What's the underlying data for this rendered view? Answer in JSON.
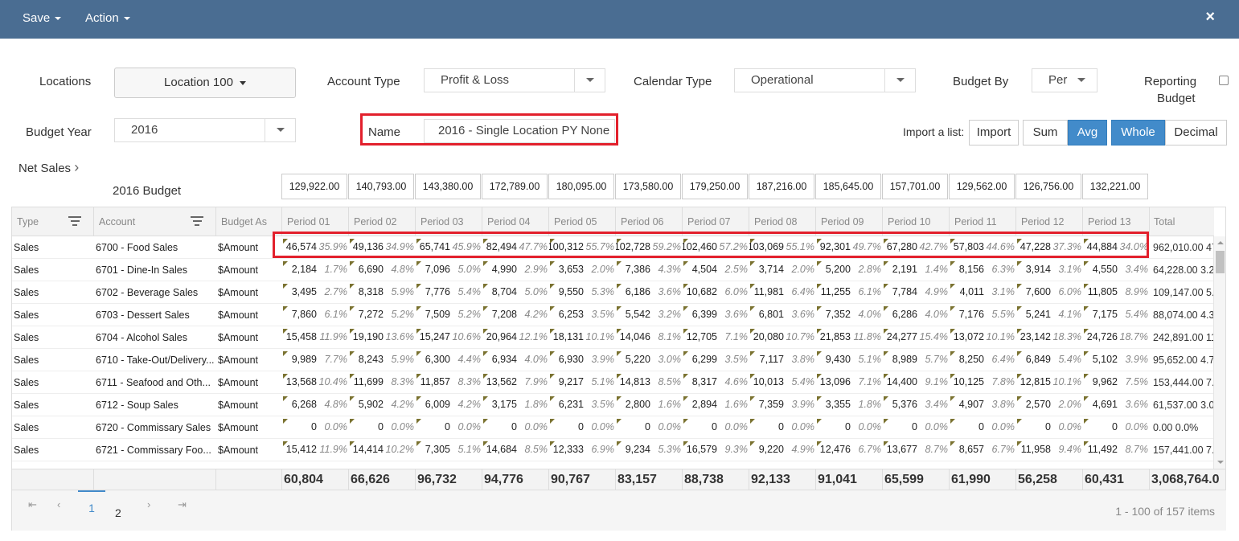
{
  "topbar": {
    "save_label": "Save",
    "action_label": "Action",
    "close_icon": "×"
  },
  "filters": {
    "locations_label": "Locations",
    "location_value": "Location 100",
    "account_type_label": "Account Type",
    "account_type_value": "Profit & Loss",
    "calendar_type_label": "Calendar Type",
    "calendar_type_value": "Operational",
    "budget_by_label": "Budget By",
    "budget_by_value": "Per",
    "reporting_budget_label_1": "Reporting",
    "reporting_budget_label_2": "Budget",
    "budget_year_label": "Budget Year",
    "budget_year_value": "2016",
    "name_label": "Name",
    "name_value": "2016 - Single Location PY None",
    "import_list_label": "Import a list:",
    "import_button": "Import",
    "sum_button": "Sum",
    "avg_button": "Avg",
    "whole_button": "Whole",
    "decimal_button": "Decimal"
  },
  "net_sales_label": "Net Sales",
  "budget_row": {
    "label": "2016 Budget",
    "values": [
      "129,922.00",
      "140,793.00",
      "143,380.00",
      "172,789.00",
      "180,095.00",
      "173,580.00",
      "179,250.00",
      "187,216.00",
      "185,645.00",
      "157,701.00",
      "129,562.00",
      "126,756.00",
      "132,221.00"
    ]
  },
  "grid": {
    "columns": {
      "type": "Type",
      "account": "Account",
      "budget_as": "Budget As",
      "periods": [
        "Period 01",
        "Period 02",
        "Period 03",
        "Period 04",
        "Period 05",
        "Period 06",
        "Period 07",
        "Period 08",
        "Period 09",
        "Period 10",
        "Period 11",
        "Period 12",
        "Period 13"
      ],
      "total": "Total"
    },
    "rows": [
      {
        "type": "Sales",
        "account": "6700 - Food Sales",
        "budget_as": "$Amount",
        "cells": [
          [
            "46,574",
            "35.9%"
          ],
          [
            "49,136",
            "34.9%"
          ],
          [
            "65,741",
            "45.9%"
          ],
          [
            "82,494",
            "47.7%"
          ],
          [
            "100,312",
            "55.7%"
          ],
          [
            "102,728",
            "59.2%"
          ],
          [
            "102,460",
            "57.2%"
          ],
          [
            "103,069",
            "55.1%"
          ],
          [
            "92,301",
            "49.7%"
          ],
          [
            "67,280",
            "42.7%"
          ],
          [
            "57,803",
            "44.6%"
          ],
          [
            "47,228",
            "37.3%"
          ],
          [
            "44,884",
            "34.0%"
          ]
        ],
        "total": "962,010.00 47"
      },
      {
        "type": "Sales",
        "account": "6701 - Dine-In Sales",
        "budget_as": "$Amount",
        "cells": [
          [
            "2,184",
            "1.7%"
          ],
          [
            "6,690",
            "4.8%"
          ],
          [
            "7,096",
            "5.0%"
          ],
          [
            "4,990",
            "2.9%"
          ],
          [
            "3,653",
            "2.0%"
          ],
          [
            "7,386",
            "4.3%"
          ],
          [
            "4,504",
            "2.5%"
          ],
          [
            "3,714",
            "2.0%"
          ],
          [
            "5,200",
            "2.8%"
          ],
          [
            "2,191",
            "1.4%"
          ],
          [
            "8,156",
            "6.3%"
          ],
          [
            "3,914",
            "3.1%"
          ],
          [
            "4,550",
            "3.4%"
          ]
        ],
        "total": "64,228.00 3.2"
      },
      {
        "type": "Sales",
        "account": "6702 - Beverage Sales",
        "budget_as": "$Amount",
        "cells": [
          [
            "3,495",
            "2.7%"
          ],
          [
            "8,318",
            "5.9%"
          ],
          [
            "7,776",
            "5.4%"
          ],
          [
            "8,704",
            "5.0%"
          ],
          [
            "9,550",
            "5.3%"
          ],
          [
            "6,186",
            "3.6%"
          ],
          [
            "10,682",
            "6.0%"
          ],
          [
            "11,981",
            "6.4%"
          ],
          [
            "11,255",
            "6.1%"
          ],
          [
            "7,784",
            "4.9%"
          ],
          [
            "4,011",
            "3.1%"
          ],
          [
            "7,600",
            "6.0%"
          ],
          [
            "11,805",
            "8.9%"
          ]
        ],
        "total": "109,147.00 5.4"
      },
      {
        "type": "Sales",
        "account": "6703 - Dessert Sales",
        "budget_as": "$Amount",
        "cells": [
          [
            "7,860",
            "6.1%"
          ],
          [
            "7,272",
            "5.2%"
          ],
          [
            "7,509",
            "5.2%"
          ],
          [
            "7,208",
            "4.2%"
          ],
          [
            "6,253",
            "3.5%"
          ],
          [
            "5,542",
            "3.2%"
          ],
          [
            "6,399",
            "3.6%"
          ],
          [
            "6,801",
            "3.6%"
          ],
          [
            "7,352",
            "4.0%"
          ],
          [
            "6,286",
            "4.0%"
          ],
          [
            "7,176",
            "5.5%"
          ],
          [
            "5,241",
            "4.1%"
          ],
          [
            "7,175",
            "5.4%"
          ]
        ],
        "total": "88,074.00 4.3"
      },
      {
        "type": "Sales",
        "account": "6704 - Alcohol Sales",
        "budget_as": "$Amount",
        "cells": [
          [
            "15,458",
            "11.9%"
          ],
          [
            "19,190",
            "13.6%"
          ],
          [
            "15,247",
            "10.6%"
          ],
          [
            "20,964",
            "12.1%"
          ],
          [
            "18,131",
            "10.1%"
          ],
          [
            "14,046",
            "8.1%"
          ],
          [
            "12,705",
            "7.1%"
          ],
          [
            "20,080",
            "10.7%"
          ],
          [
            "21,853",
            "11.8%"
          ],
          [
            "24,277",
            "15.4%"
          ],
          [
            "13,072",
            "10.1%"
          ],
          [
            "23,142",
            "18.3%"
          ],
          [
            "24,726",
            "18.7%"
          ]
        ],
        "total": "242,891.00 11"
      },
      {
        "type": "Sales",
        "account": "6710 - Take-Out/Delivery...",
        "budget_as": "$Amount",
        "cells": [
          [
            "9,989",
            "7.7%"
          ],
          [
            "8,243",
            "5.9%"
          ],
          [
            "6,300",
            "4.4%"
          ],
          [
            "6,934",
            "4.0%"
          ],
          [
            "6,930",
            "3.9%"
          ],
          [
            "5,220",
            "3.0%"
          ],
          [
            "6,299",
            "3.5%"
          ],
          [
            "7,117",
            "3.8%"
          ],
          [
            "9,430",
            "5.1%"
          ],
          [
            "8,989",
            "5.7%"
          ],
          [
            "8,250",
            "6.4%"
          ],
          [
            "6,849",
            "5.4%"
          ],
          [
            "5,102",
            "3.9%"
          ]
        ],
        "total": "95,652.00 4.7"
      },
      {
        "type": "Sales",
        "account": "6711 - Seafood and Oth...",
        "budget_as": "$Amount",
        "cells": [
          [
            "13,568",
            "10.4%"
          ],
          [
            "11,699",
            "8.3%"
          ],
          [
            "11,857",
            "8.3%"
          ],
          [
            "13,562",
            "7.9%"
          ],
          [
            "9,217",
            "5.1%"
          ],
          [
            "14,813",
            "8.5%"
          ],
          [
            "8,317",
            "4.6%"
          ],
          [
            "10,013",
            "5.4%"
          ],
          [
            "13,096",
            "7.1%"
          ],
          [
            "14,400",
            "9.1%"
          ],
          [
            "10,125",
            "7.8%"
          ],
          [
            "12,815",
            "10.1%"
          ],
          [
            "9,962",
            "7.5%"
          ]
        ],
        "total": "153,444.00 7.5"
      },
      {
        "type": "Sales",
        "account": "6712 - Soup Sales",
        "budget_as": "$Amount",
        "cells": [
          [
            "6,268",
            "4.8%"
          ],
          [
            "5,902",
            "4.2%"
          ],
          [
            "6,009",
            "4.2%"
          ],
          [
            "3,175",
            "1.8%"
          ],
          [
            "6,231",
            "3.5%"
          ],
          [
            "2,800",
            "1.6%"
          ],
          [
            "2,894",
            "1.6%"
          ],
          [
            "7,359",
            "3.9%"
          ],
          [
            "3,355",
            "1.8%"
          ],
          [
            "5,376",
            "3.4%"
          ],
          [
            "4,907",
            "3.8%"
          ],
          [
            "2,570",
            "2.0%"
          ],
          [
            "4,691",
            "3.6%"
          ]
        ],
        "total": "61,537.00 3.0"
      },
      {
        "type": "Sales",
        "account": "6720 - Commissary Sales",
        "budget_as": "$Amount",
        "cells": [
          [
            "0",
            "0.0%"
          ],
          [
            "0",
            "0.0%"
          ],
          [
            "0",
            "0.0%"
          ],
          [
            "0",
            "0.0%"
          ],
          [
            "0",
            "0.0%"
          ],
          [
            "0",
            "0.0%"
          ],
          [
            "0",
            "0.0%"
          ],
          [
            "0",
            "0.0%"
          ],
          [
            "0",
            "0.0%"
          ],
          [
            "0",
            "0.0%"
          ],
          [
            "0",
            "0.0%"
          ],
          [
            "0",
            "0.0%"
          ],
          [
            "0",
            "0.0%"
          ]
        ],
        "total": "0.00 0.0%"
      },
      {
        "type": "Sales",
        "account": "6721 - Commissary Foo...",
        "budget_as": "$Amount",
        "cells": [
          [
            "15,412",
            "11.9%"
          ],
          [
            "14,414",
            "10.2%"
          ],
          [
            "7,305",
            "5.1%"
          ],
          [
            "14,684",
            "8.5%"
          ],
          [
            "12,333",
            "6.9%"
          ],
          [
            "9,234",
            "5.3%"
          ],
          [
            "16,579",
            "9.3%"
          ],
          [
            "9,220",
            "4.9%"
          ],
          [
            "12,476",
            "6.7%"
          ],
          [
            "13,677",
            "8.7%"
          ],
          [
            "8,657",
            "6.7%"
          ],
          [
            "11,958",
            "9.4%"
          ],
          [
            "11,492",
            "8.7%"
          ]
        ],
        "total": "157,441.00 7.7"
      }
    ],
    "footer_totals": [
      "60,804",
      "66,626",
      "96,732",
      "94,776",
      "90,767",
      "83,157",
      "88,738",
      "92,133",
      "91,041",
      "65,599",
      "61,990",
      "56,258",
      "60,431",
      "3,068,764.0"
    ],
    "pager": {
      "pages": [
        "1",
        "2"
      ],
      "info": "1 - 100 of 157 items"
    }
  },
  "colors": {
    "topbar": "#4a6d92",
    "active_button": "#428bca",
    "highlight": "#e2202c",
    "marker": "#7a7230"
  }
}
